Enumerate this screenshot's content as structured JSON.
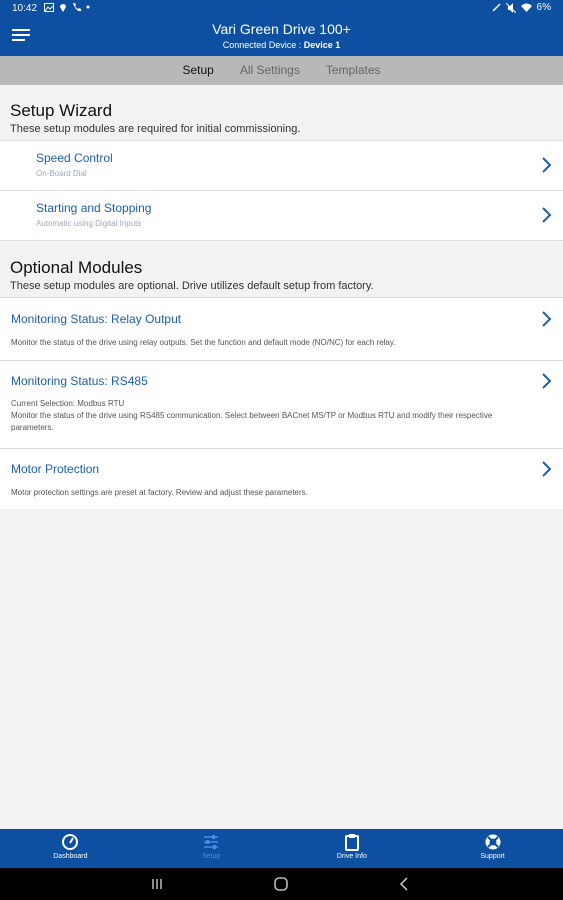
{
  "status_bar": {
    "time": "10:42",
    "battery": "6%"
  },
  "header": {
    "title": "Vari Green Drive 100+",
    "connected_label": "Connected Device :",
    "device_name": "Device 1"
  },
  "tabs": [
    {
      "label": "Setup",
      "active": true
    },
    {
      "label": "All Settings",
      "active": false
    },
    {
      "label": "Templates",
      "active": false
    }
  ],
  "setup_wizard": {
    "title": "Setup Wizard",
    "description": "These setup modules are required for initial commissioning.",
    "items": [
      {
        "title": "Speed Control",
        "subtitle": "On-Board Dial"
      },
      {
        "title": "Starting and Stopping",
        "subtitle": "Automatic using Digital Inputs"
      }
    ]
  },
  "optional_modules": {
    "title": "Optional Modules",
    "description": "These setup modules are optional.  Drive utilizes default setup from factory.",
    "items": [
      {
        "title": "Monitoring Status: Relay Output",
        "description": "Monitor the status of the drive using relay outputs.  Set the function and default mode (NO/NC) for each relay."
      },
      {
        "title": "Monitoring Status: RS485",
        "current": "Current Selection: Modbus RTU",
        "description": "Monitor the status of the drive using RS485 communication.  Select between BACnet MS/TP or Modbus RTU and modify their respective parameters."
      },
      {
        "title": "Motor Protection",
        "description": "Motor protection settings are preset at factory.  Review and adjust these parameters."
      }
    ]
  },
  "bottom_nav": [
    {
      "label": "Dashboard",
      "icon": "gauge-icon",
      "active": false
    },
    {
      "label": "Setup",
      "icon": "sliders-icon",
      "active": true
    },
    {
      "label": "Drive Info",
      "icon": "clipboard-icon",
      "active": false
    },
    {
      "label": "Support",
      "icon": "lifebuoy-icon",
      "active": false
    }
  ],
  "colors": {
    "primary": "#0d4fa0",
    "link": "#1d5ea8",
    "tab_bar": "#b8b8b8",
    "active_nav": "#4a90e2"
  }
}
